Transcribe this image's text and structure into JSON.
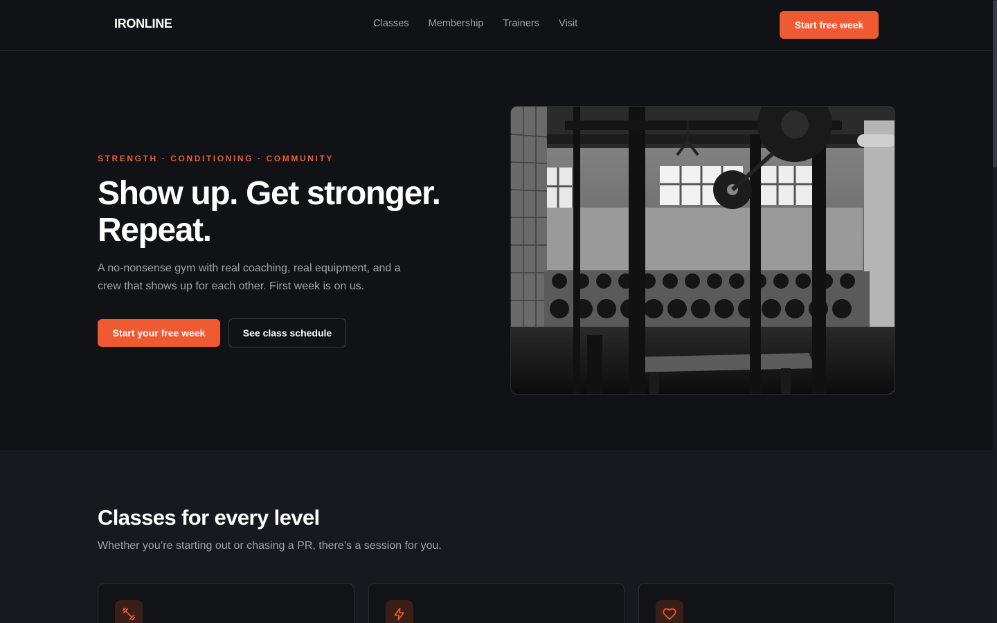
{
  "header": {
    "logo": "IRONLINE",
    "nav": [
      "Classes",
      "Membership",
      "Trainers",
      "Visit"
    ],
    "cta": "Start free week"
  },
  "hero": {
    "eyebrow": "STRENGTH · CONDITIONING · COMMUNITY",
    "title": "Show up. Get stronger. Repeat.",
    "description": "A no-nonsense gym with real coaching, real equipment, and a crew that shows up for each other. First week is on us.",
    "primary_cta": "Start your free week",
    "secondary_cta": "See class schedule",
    "image_alt": "Black and white gym interior with squat racks, dumbbell rows and benches"
  },
  "classes": {
    "title": "Classes for every level",
    "subtitle": "Whether you’re starting out or chasing a PR, there’s a session for you.",
    "cards": [
      {
        "icon": "dumbbell-icon"
      },
      {
        "icon": "lightning-icon"
      },
      {
        "icon": "heart-icon"
      }
    ]
  },
  "colors": {
    "accent": "#f05a32",
    "background": "#111216",
    "section_background": "#18191e",
    "muted_text": "#a1a1aa"
  }
}
